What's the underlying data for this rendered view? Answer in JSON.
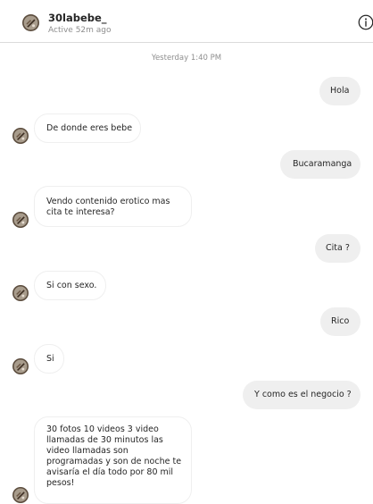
{
  "header": {
    "username": "30labebe_",
    "status": "Active 52m ago",
    "avatar_icon": "profile-avatar",
    "info_icon": "info-icon"
  },
  "thread": {
    "timestamp": "Yesterday 1:40 PM"
  },
  "messages": [
    {
      "from": "me",
      "text": "Hola"
    },
    {
      "from": "them",
      "text": "De donde eres bebe"
    },
    {
      "from": "me",
      "text": "Bucaramanga"
    },
    {
      "from": "them",
      "text": "Vendo contenido erotico mas\ncita te interesa?"
    },
    {
      "from": "me",
      "text": "Cita ?"
    },
    {
      "from": "them",
      "text": "Si con sexo."
    },
    {
      "from": "me",
      "text": "Rico"
    },
    {
      "from": "them",
      "text": "Si"
    },
    {
      "from": "me",
      "text": "Y como es el negocio ?"
    },
    {
      "from": "them",
      "text": "30 fotos 10 videos 3 video\nllamadas de 30 minutos las\nvideo llamadas son\nprogramadas y son de noche te\navisaría el día todo por 80 mil\npesos!"
    }
  ],
  "colors": {
    "sent_bubble": "#efefef",
    "received_border": "#efefef",
    "muted_text": "#8e8e8e"
  }
}
